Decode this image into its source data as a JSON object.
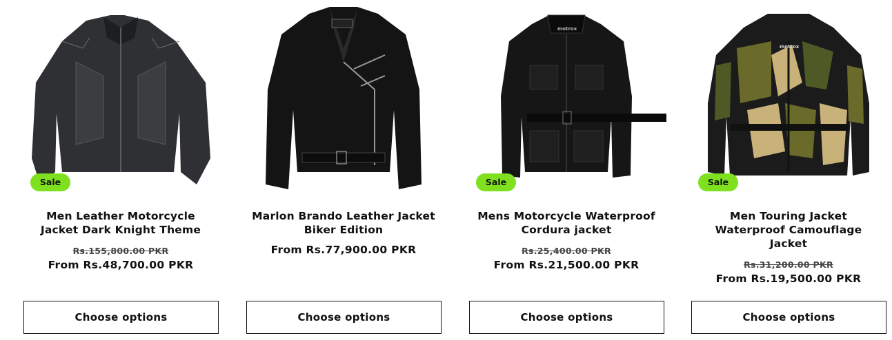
{
  "products": [
    {
      "badge": "Sale",
      "title_line1": "Men Leather Motorcycle",
      "title_line2": "Jacket Dark Knight Theme",
      "title_line3": "",
      "old_price": "Rs.155,800.00 PKR",
      "price": "From Rs.48,700.00 PKR",
      "button": "Choose options"
    },
    {
      "badge": "",
      "title_line1": "Marlon Brando Leather Jacket",
      "title_line2": "Biker Edition",
      "title_line3": "",
      "old_price": "",
      "price": "From Rs.77,900.00 PKR",
      "button": "Choose options"
    },
    {
      "badge": "Sale",
      "title_line1": "Mens Motorcycle Waterproof",
      "title_line2": "Cordura jacket",
      "title_line3": "",
      "old_price": "Rs.25,400.00 PKR",
      "price": "From Rs.21,500.00 PKR",
      "button": "Choose options"
    },
    {
      "badge": "Sale",
      "title_line1": "Men Touring Jacket",
      "title_line2": "Waterproof Camouflage",
      "title_line3": "Jacket",
      "old_price": "Rs.31,200.00 PKR",
      "price": "From Rs.19,500.00 PKR",
      "button": "Choose options"
    }
  ],
  "logo_text": "motrox",
  "colors": {
    "sale_badge": "#7ee01e",
    "text": "#111111",
    "button_border": "#111111"
  }
}
